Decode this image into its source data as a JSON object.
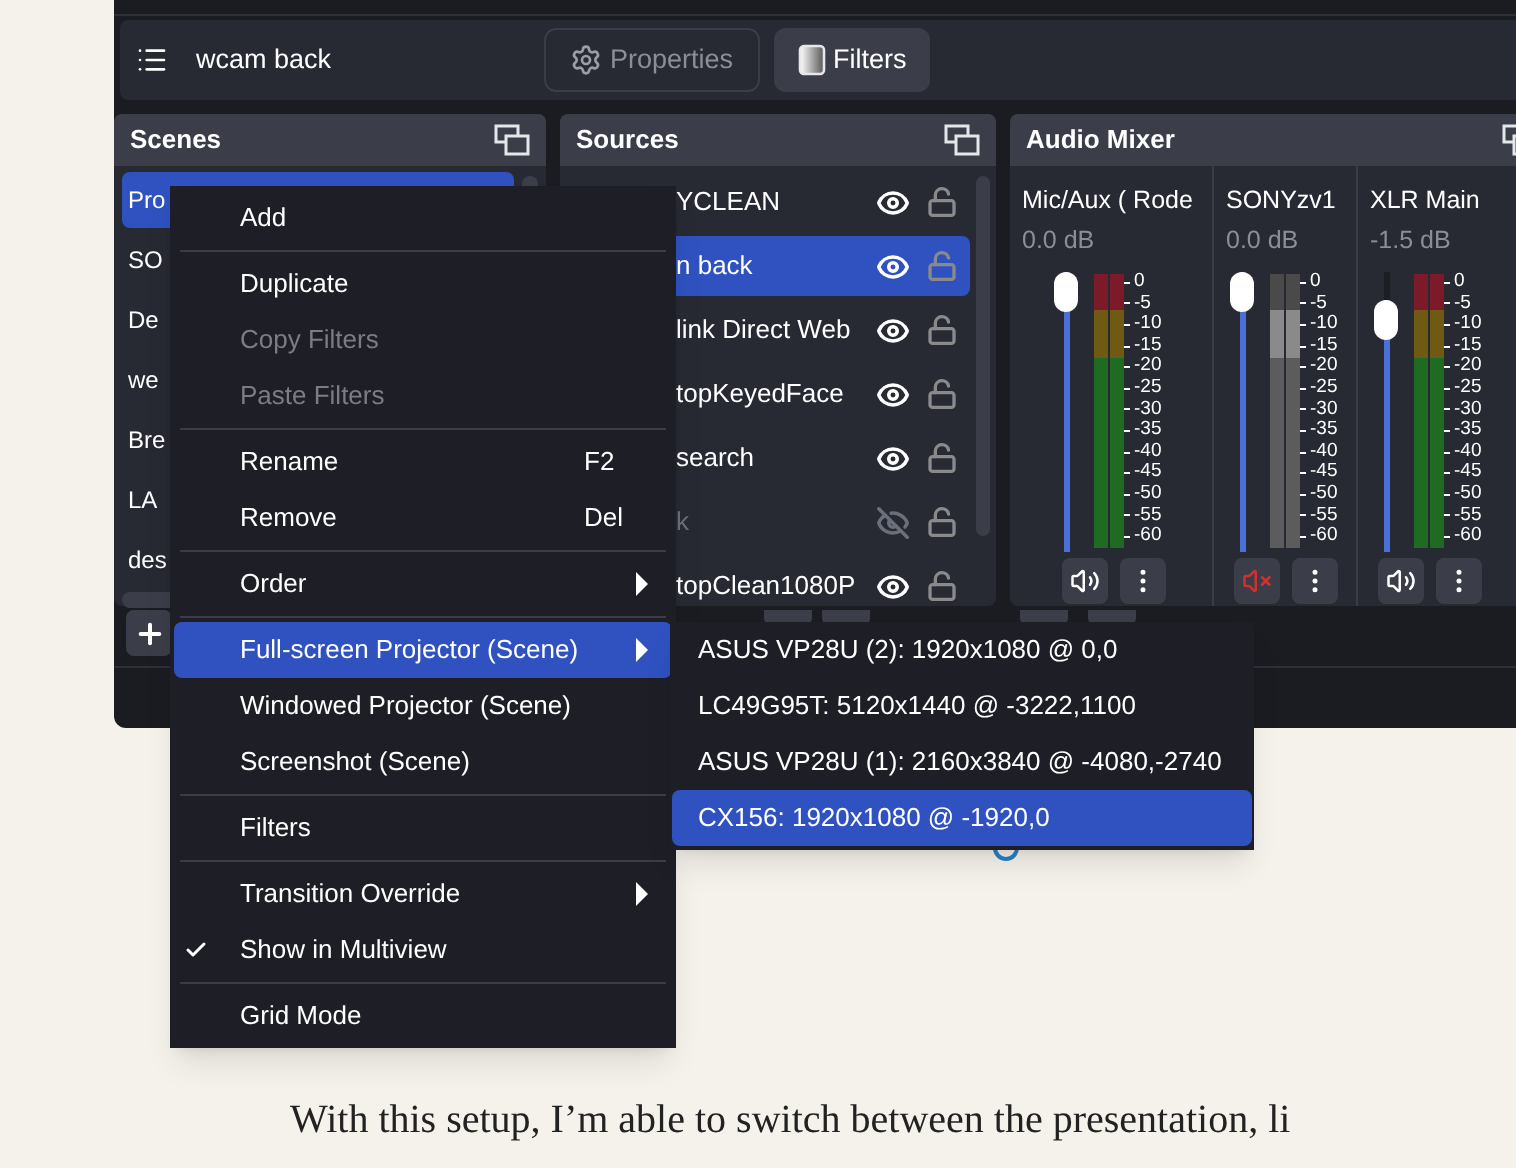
{
  "toolbar": {
    "source_name": "wcam back",
    "buttons": [
      {
        "label": "Properties",
        "kind": "properties",
        "selected": false
      },
      {
        "label": "Filters",
        "kind": "filters",
        "selected": true
      }
    ]
  },
  "scenes": {
    "title": "Scenes",
    "items": [
      {
        "label": "Pro",
        "selected": true
      },
      {
        "label": "SO",
        "selected": false
      },
      {
        "label": "De",
        "selected": false
      },
      {
        "label": "we",
        "selected": false
      },
      {
        "label": "Bre",
        "selected": false
      },
      {
        "label": "LA",
        "selected": false
      },
      {
        "label": "des",
        "selected": false
      }
    ]
  },
  "sources": {
    "title": "Sources",
    "items": [
      {
        "label": "YCLEAN",
        "selected": false,
        "visible": true
      },
      {
        "label": "n back",
        "selected": true,
        "visible": true
      },
      {
        "label": "link Direct Web",
        "selected": false,
        "visible": true
      },
      {
        "label": "topKeyedFace",
        "selected": false,
        "visible": true
      },
      {
        "label": "search",
        "selected": false,
        "visible": true
      },
      {
        "label": "k",
        "selected": false,
        "visible": false
      },
      {
        "label": "topClean1080P",
        "selected": false,
        "visible": true
      }
    ]
  },
  "audio_mixer": {
    "title": "Audio Mixer",
    "channels": [
      {
        "name": "Mic/Aux ( Rode",
        "reading": "0.0 dB",
        "level": 1,
        "muted": false,
        "scale": [
          "0",
          "-5",
          "-10",
          "-15",
          "-20",
          "-25",
          "-30",
          "-35",
          "-40",
          "-45",
          "-50",
          "-55",
          "-60"
        ]
      },
      {
        "name": "SONYzv1",
        "reading": "0.0 dB",
        "level": 1,
        "muted": true,
        "scale": [
          "0",
          "-5",
          "-10",
          "-15",
          "-20",
          "-25",
          "-30",
          "-35",
          "-40",
          "-45",
          "-50",
          "-55",
          "-60"
        ]
      },
      {
        "name": "XLR Main",
        "reading": "-1.5 dB",
        "level": 0.9,
        "muted": false,
        "scale": [
          "0",
          "-5",
          "-10",
          "-15",
          "-20",
          "-25",
          "-30",
          "-35",
          "-40",
          "-45",
          "-50",
          "-55",
          "-60"
        ]
      }
    ]
  },
  "context_menu": {
    "groups": [
      [
        {
          "label": "Add",
          "disabled": false,
          "checked": false,
          "submenu": false,
          "selected": false
        }
      ],
      [
        {
          "label": "Duplicate",
          "disabled": false,
          "checked": false,
          "submenu": false,
          "selected": false
        },
        {
          "label": "Copy Filters",
          "disabled": true,
          "checked": false,
          "submenu": false,
          "selected": false
        },
        {
          "label": "Paste Filters",
          "disabled": true,
          "checked": false,
          "submenu": false,
          "selected": false
        }
      ],
      [
        {
          "label": "Rename",
          "shortcut": "F2",
          "disabled": false,
          "checked": false,
          "submenu": false,
          "selected": false
        },
        {
          "label": "Remove",
          "shortcut": "Del",
          "disabled": false,
          "checked": false,
          "submenu": false,
          "selected": false
        }
      ],
      [
        {
          "label": "Order",
          "disabled": false,
          "checked": false,
          "submenu": true,
          "selected": false
        }
      ],
      [
        {
          "label": "Full-screen Projector (Scene)",
          "disabled": false,
          "checked": false,
          "submenu": true,
          "selected": true
        },
        {
          "label": "Windowed Projector (Scene)",
          "disabled": false,
          "checked": false,
          "submenu": false,
          "selected": false
        },
        {
          "label": "Screenshot (Scene)",
          "disabled": false,
          "checked": false,
          "submenu": false,
          "selected": false
        }
      ],
      [
        {
          "label": "Filters",
          "disabled": false,
          "checked": false,
          "submenu": false,
          "selected": false
        }
      ],
      [
        {
          "label": "Transition Override",
          "disabled": false,
          "checked": false,
          "submenu": true,
          "selected": false
        },
        {
          "label": "Show in Multiview",
          "disabled": false,
          "checked": true,
          "submenu": false,
          "selected": false
        }
      ],
      [
        {
          "label": "Grid Mode",
          "disabled": false,
          "checked": false,
          "submenu": false,
          "selected": false
        }
      ]
    ]
  },
  "submenu": {
    "items": [
      {
        "label": "ASUS VP28U (2): 1920x1080 @ 0,0",
        "selected": false
      },
      {
        "label": "LC49G95T: 5120x1440 @ -3222,1100",
        "selected": false
      },
      {
        "label": "ASUS VP28U (1): 2160x3840 @ -4080,-2740",
        "selected": false
      },
      {
        "label": "CX156: 1920x1080 @ -1920,0",
        "selected": true
      }
    ]
  },
  "article_text": "With this setup, I’m able to switch between the presentation, li"
}
